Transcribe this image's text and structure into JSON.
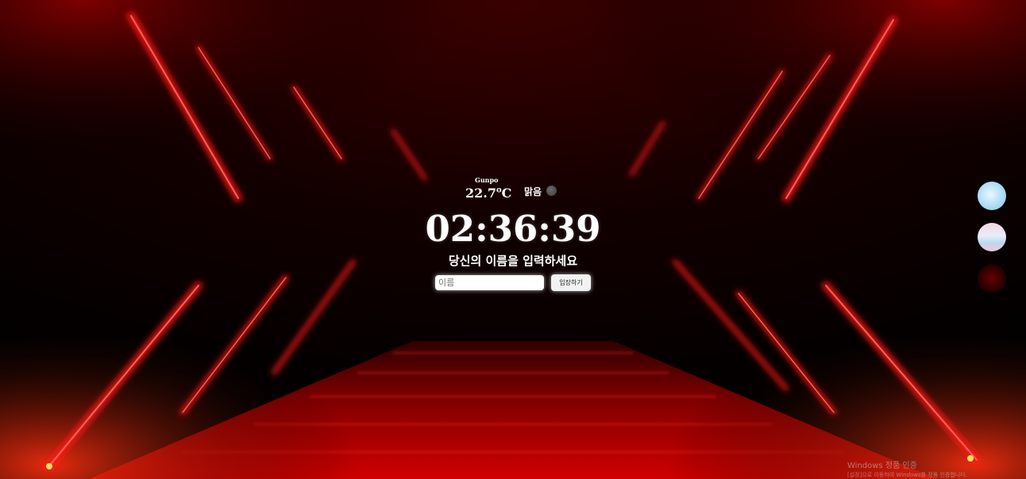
{
  "weather": {
    "city": "Gunpo",
    "temperature": "22.7",
    "unit_sup": "o",
    "unit": "C",
    "condition": "맑음",
    "condition_icon": "cloud-icon"
  },
  "clock": {
    "time": "02:36:39"
  },
  "greeting": {
    "prompt": "당신의 이름을 입력하세요"
  },
  "login": {
    "placeholder": "이름",
    "value": "",
    "button_label": "입장하기"
  },
  "themes": [
    {
      "name": "sky",
      "icon": "sky-theme-icon"
    },
    {
      "name": "pink",
      "icon": "pink-theme-icon"
    },
    {
      "name": "red",
      "icon": "red-theme-icon"
    }
  ],
  "watermark": {
    "line1": "Windows 정품 인증",
    "line2": "[설정]으로 이동하여 Windows를 정품 인증합니다."
  },
  "colors": {
    "background": "#000000",
    "accent_red": "#e01010",
    "carpet": "#b00000"
  }
}
